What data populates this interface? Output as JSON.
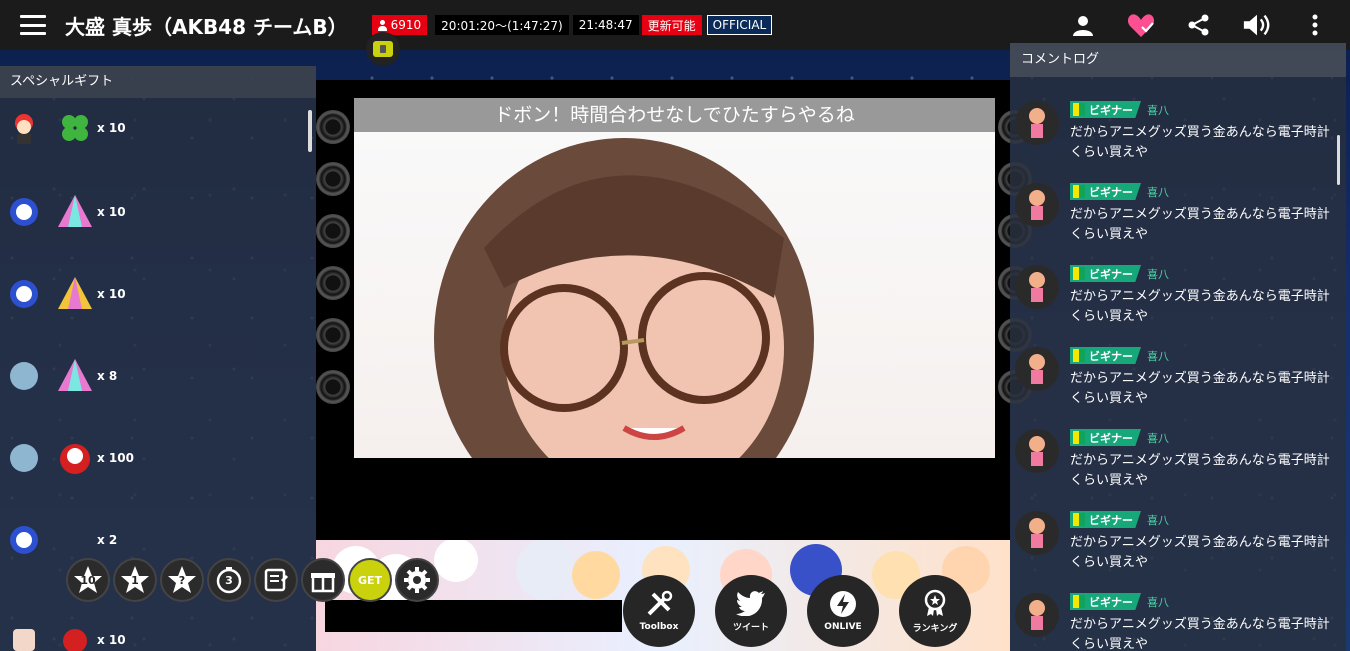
{
  "header": {
    "title": "大盛 真歩（AKB48 チームB）",
    "viewer_count": "6910",
    "time_range": "20:01:20〜(1:47:27)",
    "current_time": "21:48:47",
    "update_label": "更新可能",
    "official_label": "OFFICIAL"
  },
  "left_panel": {
    "title": "スペシャルギフト",
    "gifts": [
      {
        "icon": "clover-icon",
        "count": "x 10"
      },
      {
        "icon": "tent-pink-icon",
        "count": "x 10"
      },
      {
        "icon": "tent-yellow-icon",
        "count": "x 10"
      },
      {
        "icon": "tent-pink-icon",
        "count": "x 8"
      },
      {
        "icon": "daruma-icon",
        "count": "x 100"
      },
      {
        "icon": "gift-icon",
        "count": "x 2"
      },
      {
        "icon": "daruma-icon",
        "count": "x 10"
      }
    ],
    "tools": [
      {
        "icon": "star-10-icon",
        "num": "10"
      },
      {
        "icon": "star-1-icon",
        "num": "1"
      },
      {
        "icon": "star-random-icon",
        "num": "?"
      },
      {
        "icon": "timer-icon",
        "num": "3"
      },
      {
        "icon": "note-icon"
      },
      {
        "icon": "gift-box-icon"
      },
      {
        "icon": "get-icon",
        "num": "GET"
      },
      {
        "icon": "settings-icon"
      }
    ]
  },
  "video": {
    "telop": "ドボン！時間合わせなしでひたすらやるね"
  },
  "bottom_buttons": [
    {
      "label": "Toolbox"
    },
    {
      "label": "ツイート"
    },
    {
      "label": "ONLIVE"
    },
    {
      "label": "ランキング"
    }
  ],
  "comments": {
    "title": "コメントログ",
    "items": [
      {
        "badge": "ビギナー",
        "user": "喜八",
        "text": "だからアニメグッズ買う金あんなら電子時計くらい買えや"
      },
      {
        "badge": "ビギナー",
        "user": "喜八",
        "text": "だからアニメグッズ買う金あんなら電子時計くらい買えや"
      },
      {
        "badge": "ビギナー",
        "user": "喜八",
        "text": "だからアニメグッズ買う金あんなら電子時計くらい買えや"
      },
      {
        "badge": "ビギナー",
        "user": "喜八",
        "text": "だからアニメグッズ買う金あんなら電子時計くらい買えや"
      },
      {
        "badge": "ビギナー",
        "user": "喜八",
        "text": "だからアニメグッズ買う金あんなら電子時計くらい買えや"
      },
      {
        "badge": "ビギナー",
        "user": "喜八",
        "text": "だからアニメグッズ買う金あんなら電子時計くらい買えや"
      },
      {
        "badge": "ビギナー",
        "user": "喜八",
        "text": "だからアニメグッズ買う金あんなら電子時計くらい買えや"
      }
    ]
  },
  "colors": {
    "accent_red": "#e60012",
    "beginner_green": "#17a87a",
    "user_green": "#4fd1a5",
    "header_bg": "#1b1b1b"
  }
}
